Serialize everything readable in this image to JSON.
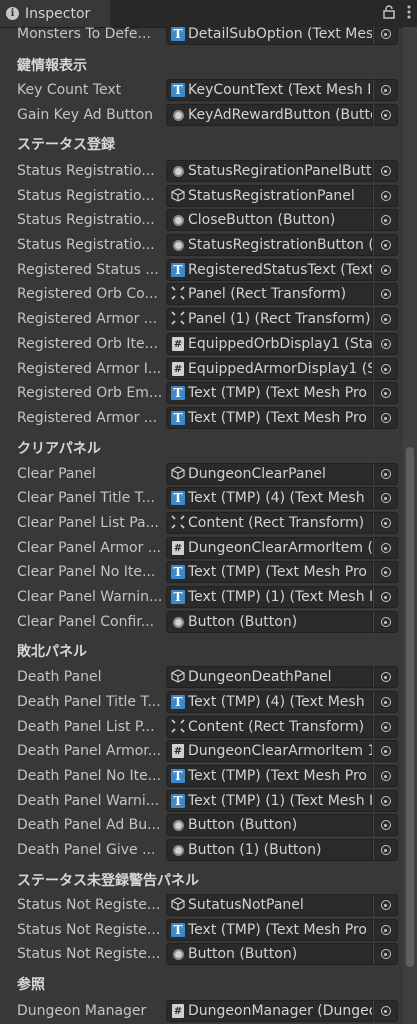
{
  "window": {
    "tab_title": "Inspector",
    "info_icon": "info-icon",
    "lock_icon": "lock-icon",
    "menu_icon": "kebab-menu-icon"
  },
  "rows": [
    {
      "kind": "field",
      "label": "Monsters To Defe...",
      "icon": "t",
      "value": "DetailSubOption (Text Mes"
    },
    {
      "kind": "header",
      "label": "鍵情報表示"
    },
    {
      "kind": "field",
      "label": "Key Count Text",
      "icon": "t",
      "value": "KeyCountText (Text Mesh I"
    },
    {
      "kind": "field",
      "label": "Gain Key Ad Button",
      "icon": "btn",
      "value": "KeyAdRewardButton (Butto"
    },
    {
      "kind": "header",
      "label": "ステータス登録"
    },
    {
      "kind": "field",
      "label": "Status Registratio...",
      "icon": "btn",
      "value": "StatusRegirationPanelButto"
    },
    {
      "kind": "field",
      "label": "Status Registratio...",
      "icon": "go",
      "value": "StatusRegistrationPanel"
    },
    {
      "kind": "field",
      "label": "Status Registratio...",
      "icon": "btn",
      "value": "CloseButton (Button)"
    },
    {
      "kind": "field",
      "label": "Status Registratio...",
      "icon": "btn",
      "value": "StatusRegistrationButton (E"
    },
    {
      "kind": "field",
      "label": "Registered Status ...",
      "icon": "t",
      "value": "RegisteredStatusText (Text"
    },
    {
      "kind": "field",
      "label": "Registered Orb Co...",
      "icon": "rect",
      "value": "Panel (Rect Transform)"
    },
    {
      "kind": "field",
      "label": "Registered Armor ...",
      "icon": "rect",
      "value": "Panel (1) (Rect Transform)"
    },
    {
      "kind": "field",
      "label": "Registered Orb Ite...",
      "icon": "script",
      "value": "EquippedOrbDisplay1 (Stat"
    },
    {
      "kind": "field",
      "label": "Registered Armor I...",
      "icon": "script",
      "value": "EquippedArmorDisplay1 (St"
    },
    {
      "kind": "field",
      "label": "Registered Orb Em...",
      "icon": "t",
      "value": "Text (TMP) (Text Mesh Pro"
    },
    {
      "kind": "field",
      "label": "Registered Armor ...",
      "icon": "t",
      "value": "Text (TMP) (Text Mesh Pro"
    },
    {
      "kind": "header",
      "label": "クリアパネル"
    },
    {
      "kind": "field",
      "label": "Clear Panel",
      "icon": "go",
      "value": "DungeonClearPanel"
    },
    {
      "kind": "field",
      "label": "Clear Panel Title T...",
      "icon": "t",
      "value": "Text (TMP) (4) (Text Mesh"
    },
    {
      "kind": "field",
      "label": "Clear Panel List Pa...",
      "icon": "rect",
      "value": "Content (Rect Transform)"
    },
    {
      "kind": "field",
      "label": "Clear Panel Armor ...",
      "icon": "script",
      "value": "DungeonClearArmorItem (D"
    },
    {
      "kind": "field",
      "label": "Clear Panel No Ite...",
      "icon": "t",
      "value": "Text (TMP) (Text Mesh Pro"
    },
    {
      "kind": "field",
      "label": "Clear Panel Warnin...",
      "icon": "t",
      "value": "Text (TMP) (1) (Text Mesh I"
    },
    {
      "kind": "field",
      "label": "Clear Panel Confir...",
      "icon": "btn",
      "value": "Button (Button)"
    },
    {
      "kind": "header",
      "label": "敗北パネル"
    },
    {
      "kind": "field",
      "label": "Death Panel",
      "icon": "go",
      "value": "DungeonDeathPanel"
    },
    {
      "kind": "field",
      "label": "Death Panel Title T...",
      "icon": "t",
      "value": "Text (TMP) (4) (Text Mesh"
    },
    {
      "kind": "field",
      "label": "Death Panel List P...",
      "icon": "rect",
      "value": "Content (Rect Transform)"
    },
    {
      "kind": "field",
      "label": "Death Panel Armor...",
      "icon": "script",
      "value": "DungeonClearArmorItem 1"
    },
    {
      "kind": "field",
      "label": "Death Panel No Ite...",
      "icon": "t",
      "value": "Text (TMP) (Text Mesh Pro"
    },
    {
      "kind": "field",
      "label": "Death Panel Warni...",
      "icon": "t",
      "value": "Text (TMP) (1) (Text Mesh I"
    },
    {
      "kind": "field",
      "label": "Death Panel Ad Bu...",
      "icon": "btn",
      "value": "Button (Button)"
    },
    {
      "kind": "field",
      "label": "Death Panel Give ...",
      "icon": "btn",
      "value": "Button (1) (Button)"
    },
    {
      "kind": "header",
      "label": "ステータス未登録警告パネル"
    },
    {
      "kind": "field",
      "label": "Status Not Registe...",
      "icon": "go",
      "value": "SutatusNotPanel"
    },
    {
      "kind": "field",
      "label": "Status Not Registe...",
      "icon": "t",
      "value": "Text (TMP) (Text Mesh Pro"
    },
    {
      "kind": "field",
      "label": "Status Not Registe...",
      "icon": "btn",
      "value": "Button (Button)"
    },
    {
      "kind": "header",
      "label": "参照"
    },
    {
      "kind": "field",
      "label": "Dungeon Manager",
      "icon": "script",
      "value": "DungeonManager (Dungeo"
    }
  ]
}
